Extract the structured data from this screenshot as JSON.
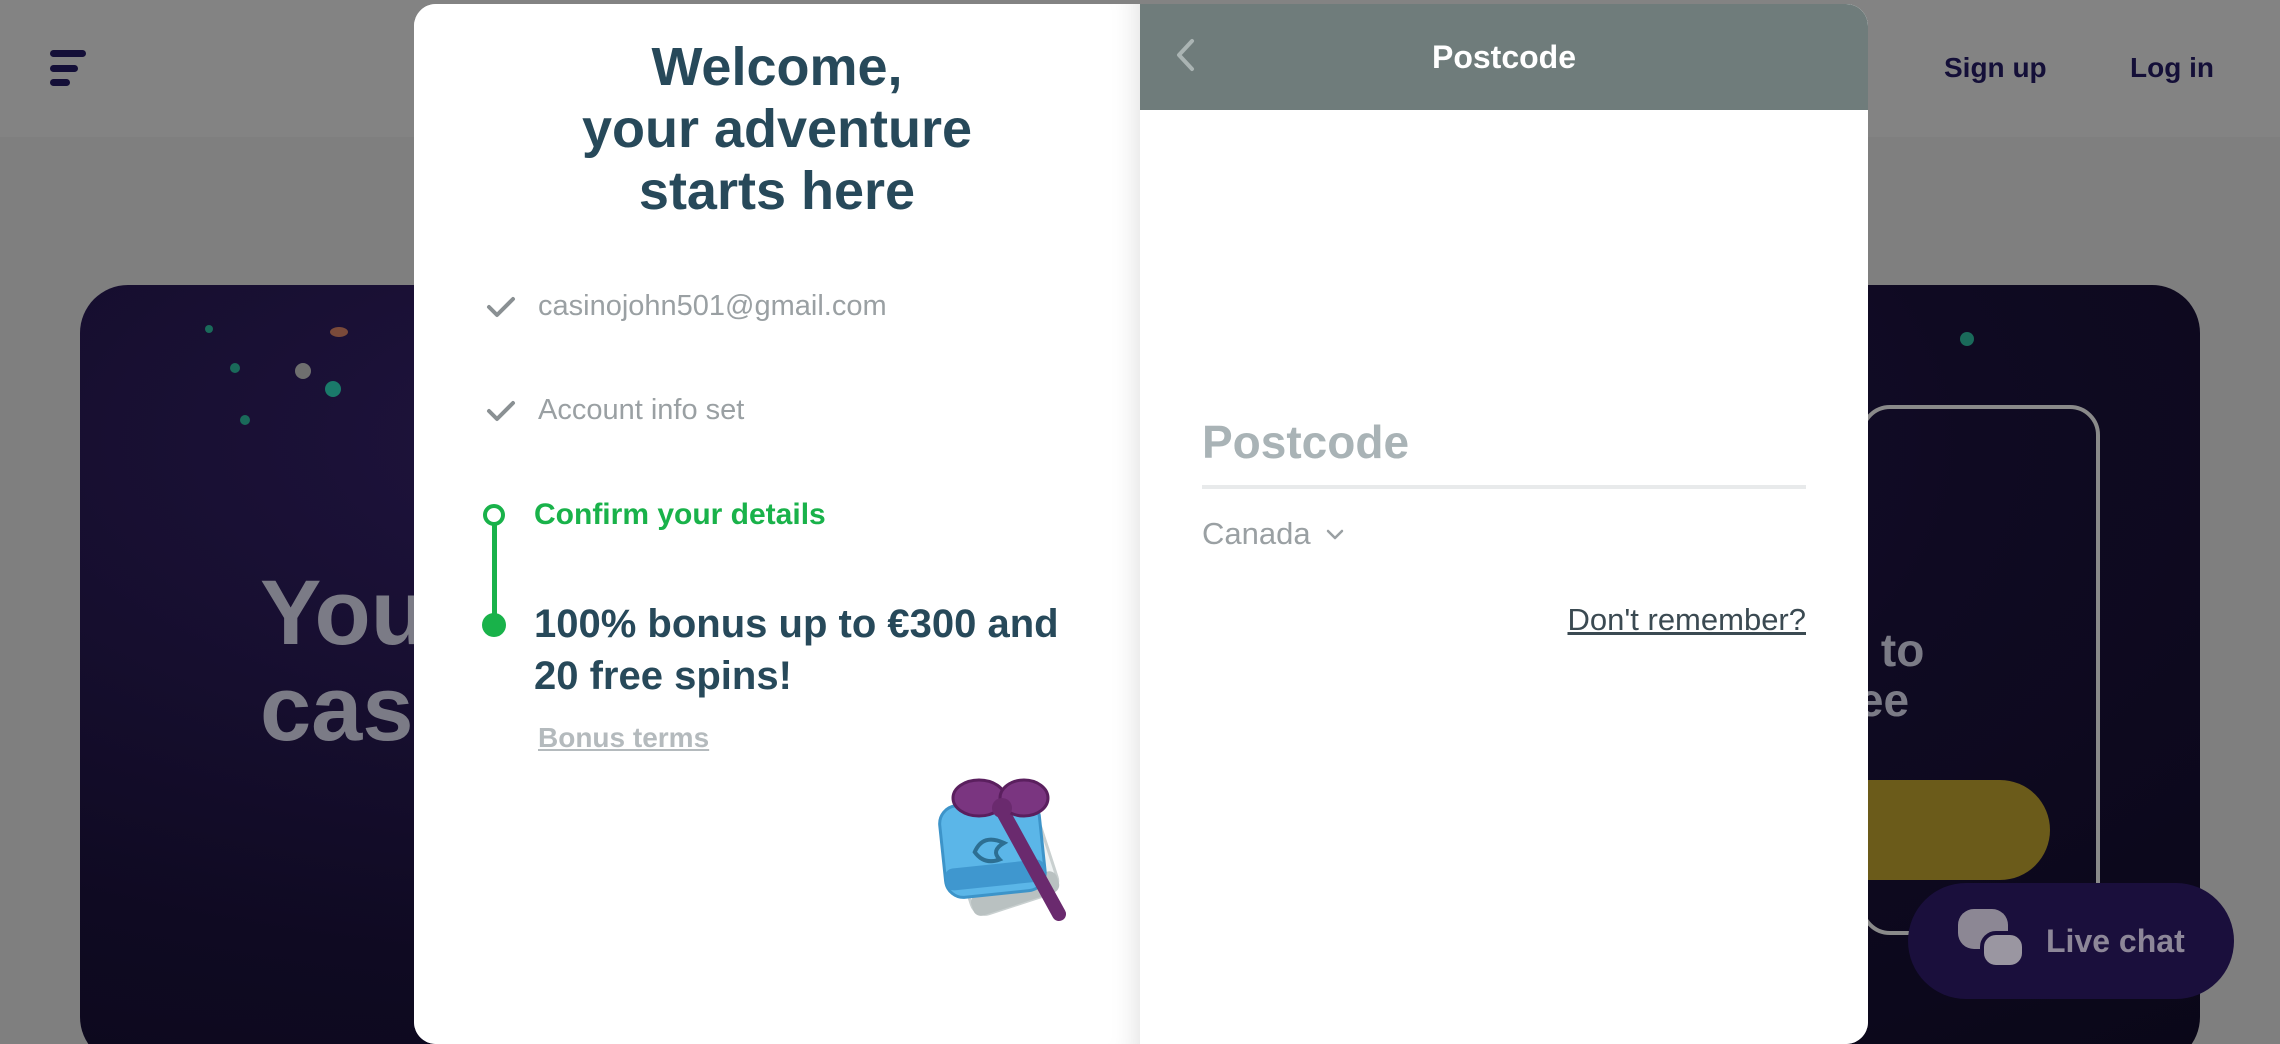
{
  "header": {
    "signup_label": "Sign up",
    "login_label": "Log in"
  },
  "hero": {
    "title": "You\ncas",
    "right_text": "p to\nree"
  },
  "livechat": {
    "label": "Live chat"
  },
  "modal": {
    "welcome": "Welcome,\nyour adventure\nstarts here",
    "steps": [
      {
        "label": "casinojohn501@gmail.com",
        "status": "done"
      },
      {
        "label": "Account info set",
        "status": "done"
      }
    ],
    "current_step": "Confirm your details",
    "bonus": "100% bonus up to €300 and 20 free spins!",
    "bonus_terms": "Bonus terms"
  },
  "form": {
    "title": "Postcode",
    "postcode_placeholder": "Postcode",
    "country": "Canada",
    "dont_remember": "Don't remember?"
  },
  "colors": {
    "accent_green": "#19b24a",
    "heading_teal": "#27495a",
    "header_gray": "#6f7c7b"
  }
}
